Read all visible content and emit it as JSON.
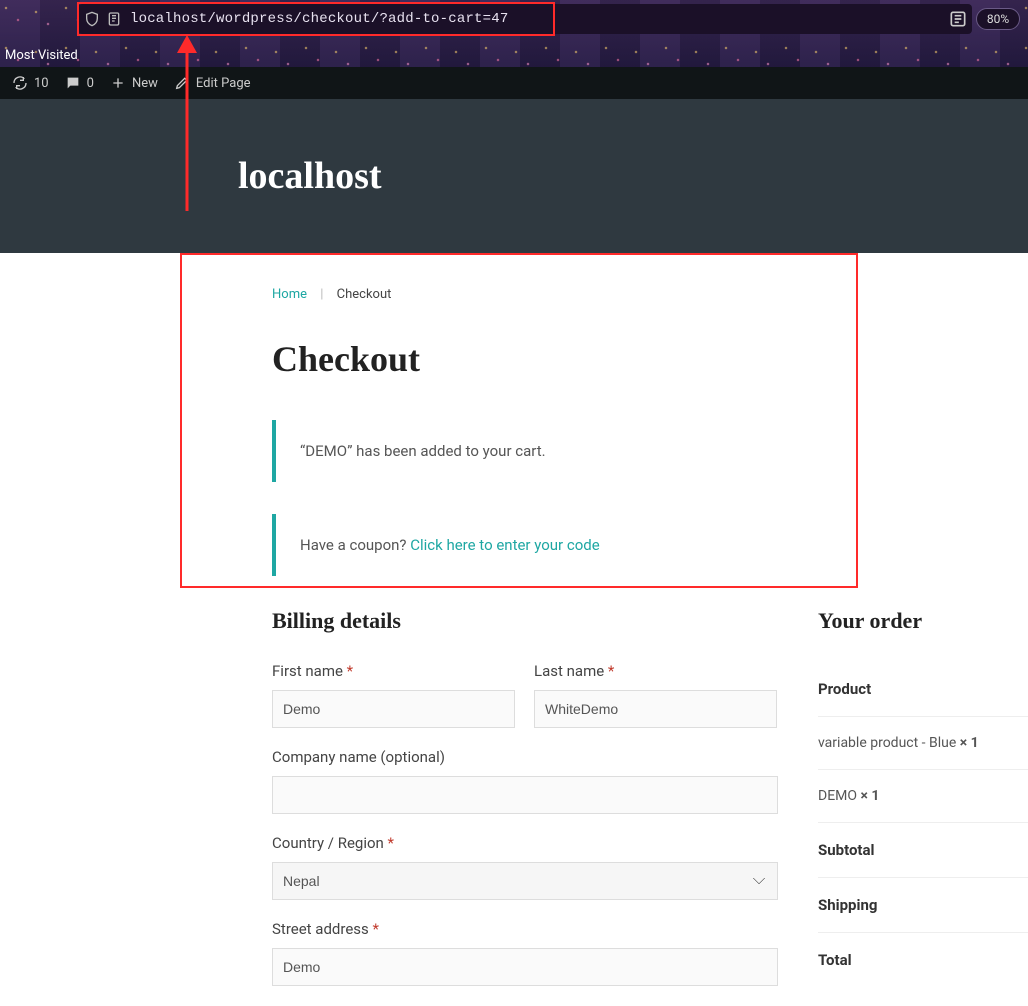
{
  "browser": {
    "url": "localhost/wordpress/checkout/?add-to-cart=47",
    "zoom": "80%",
    "most_visited_label": "Most Visited"
  },
  "wpadmin": {
    "updates": {
      "count": "10"
    },
    "comments": {
      "count": "0"
    },
    "new_label": "New",
    "edit_label": "Edit Page"
  },
  "hero": {
    "site_title": "localhost"
  },
  "breadcrumb": {
    "home": "Home",
    "current": "Checkout"
  },
  "page": {
    "title": "Checkout"
  },
  "notices": {
    "added": "“DEMO” has been added to your cart.",
    "coupon_prompt": "Have a coupon? ",
    "coupon_link": "Click here to enter your code"
  },
  "billing": {
    "heading": "Billing details",
    "first_name_label": "First name ",
    "first_name_value": "Demo",
    "last_name_label": "Last name ",
    "last_name_value": "WhiteDemo",
    "company_label": "Company name (optional)",
    "company_value": "",
    "country_label": "Country / Region ",
    "country_value": "Nepal",
    "street_label": "Street address ",
    "street_value": "Demo"
  },
  "order": {
    "heading": "Your order",
    "product_header": "Product",
    "items": [
      {
        "name": "variable product - Blue ",
        "qty": "× 1"
      },
      {
        "name": "DEMO ",
        "qty": "× 1"
      }
    ],
    "subtotal_label": "Subtotal",
    "shipping_label": "Shipping",
    "total_label": "Total"
  }
}
